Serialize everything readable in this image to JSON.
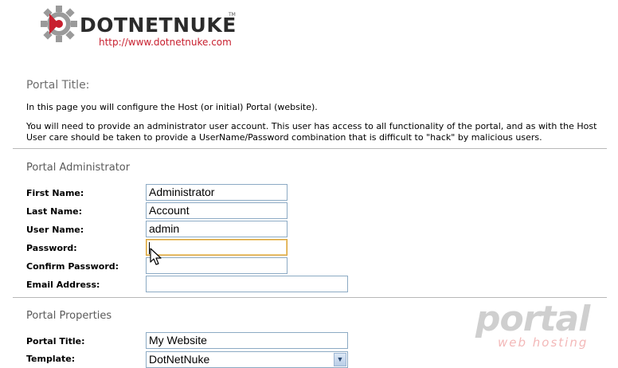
{
  "logo": {
    "wordmark": "DOTNETNUKE",
    "trademark": "TM",
    "url": "http://www.dotnetnuke.com"
  },
  "page": {
    "heading": "Portal Title:",
    "intro": "In this page you will configure the Host (or initial) Portal (website).",
    "description": "You will need to provide an administrator user account. This user has access to all functionality of the portal, and as with the Host User care should be taken to provide a UserName/Password combination that is difficult to \"hack\" by malicious users."
  },
  "admin_section": {
    "title": "Portal Administrator",
    "fields": {
      "first_name": {
        "label": "First Name:",
        "value": "Administrator"
      },
      "last_name": {
        "label": "Last Name:",
        "value": "Account"
      },
      "user_name": {
        "label": "User Name:",
        "value": "admin"
      },
      "password": {
        "label": "Password:",
        "value": ""
      },
      "confirm_password": {
        "label": "Confirm Password:",
        "value": ""
      },
      "email": {
        "label": "Email Address:",
        "value": ""
      }
    }
  },
  "properties_section": {
    "title": "Portal Properties",
    "fields": {
      "portal_title": {
        "label": "Portal Title:",
        "value": "My Website"
      },
      "template": {
        "label": "Template:",
        "value": "DotNetNuke"
      }
    }
  },
  "watermark": {
    "word": "portal",
    "sub": "web hosting"
  },
  "colors": {
    "logo_red": "#c8202f",
    "focus_border": "#d8a23a",
    "input_border": "#8caac4"
  }
}
